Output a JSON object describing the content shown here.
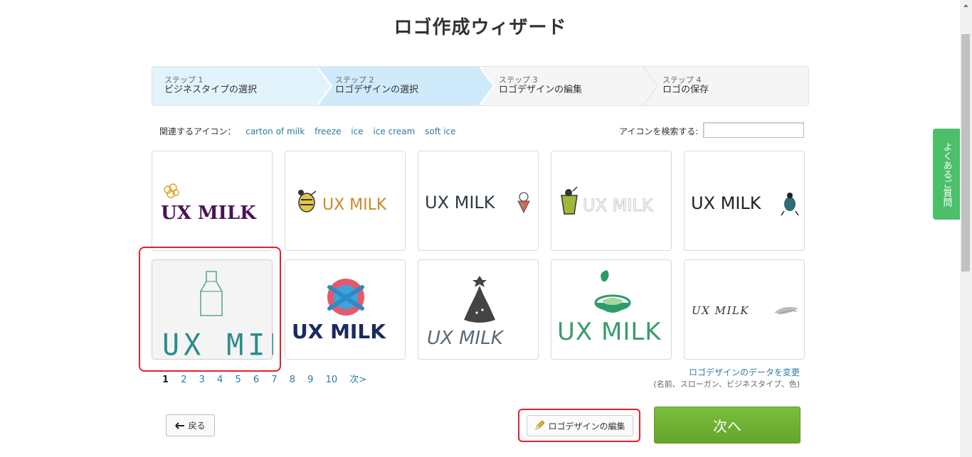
{
  "page": {
    "title": "ロゴ作成ウィザード"
  },
  "steps": [
    {
      "num": "ステップ 1",
      "label": "ビジネスタイプの選択",
      "state": "done"
    },
    {
      "num": "ステップ 2",
      "label": "ロゴデザインの選択",
      "state": "current"
    },
    {
      "num": "ステップ 3",
      "label": "ロゴデザインの編集",
      "state": "todo"
    },
    {
      "num": "ステップ 4",
      "label": "ロゴの保存",
      "state": "todo"
    }
  ],
  "related": {
    "label": "関連するアイコン：",
    "tags": [
      "carton of milk",
      "freeze",
      "ice",
      "ice cream",
      "soft ice"
    ]
  },
  "search": {
    "label": "アイコンを検索する:",
    "value": ""
  },
  "logo_text": "UX MILK",
  "pagination": {
    "current": "1",
    "pages": [
      "1",
      "2",
      "3",
      "4",
      "5",
      "6",
      "7",
      "8",
      "9",
      "10"
    ],
    "next": "次>"
  },
  "change_data": {
    "link": "ロゴデザインのデータを変更",
    "sub": "(名前、スローガン、ビジネスタイプ、色)"
  },
  "buttons": {
    "back": "戻る",
    "edit": "ロゴデザインの編集",
    "next": "次へ"
  },
  "faq": {
    "label": "よくあるご質問"
  },
  "colors": {
    "step_done": "#e3f3fc",
    "step_current": "#cfeafb",
    "accent_link": "#2a7ba8",
    "next_green": "#6aab30",
    "faq_green": "#4cbf6b",
    "highlight_red": "#e0222c",
    "purple": "#4b1257",
    "orange": "#c98a2a",
    "navy": "#1a2a5e",
    "teal": "#2b8c8c",
    "green": "#3a9a6a"
  }
}
